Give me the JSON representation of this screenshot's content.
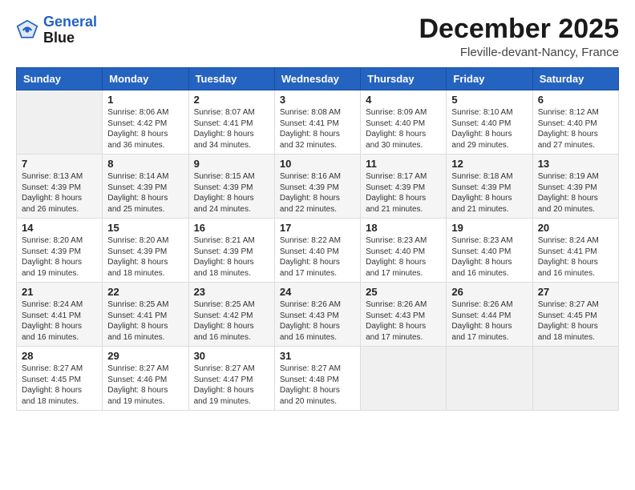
{
  "header": {
    "logo_line1": "General",
    "logo_line2": "Blue",
    "month": "December 2025",
    "location": "Fleville-devant-Nancy, France"
  },
  "days_of_week": [
    "Sunday",
    "Monday",
    "Tuesday",
    "Wednesday",
    "Thursday",
    "Friday",
    "Saturday"
  ],
  "weeks": [
    [
      {
        "day": "",
        "info": ""
      },
      {
        "day": "1",
        "info": "Sunrise: 8:06 AM\nSunset: 4:42 PM\nDaylight: 8 hours\nand 36 minutes."
      },
      {
        "day": "2",
        "info": "Sunrise: 8:07 AM\nSunset: 4:41 PM\nDaylight: 8 hours\nand 34 minutes."
      },
      {
        "day": "3",
        "info": "Sunrise: 8:08 AM\nSunset: 4:41 PM\nDaylight: 8 hours\nand 32 minutes."
      },
      {
        "day": "4",
        "info": "Sunrise: 8:09 AM\nSunset: 4:40 PM\nDaylight: 8 hours\nand 30 minutes."
      },
      {
        "day": "5",
        "info": "Sunrise: 8:10 AM\nSunset: 4:40 PM\nDaylight: 8 hours\nand 29 minutes."
      },
      {
        "day": "6",
        "info": "Sunrise: 8:12 AM\nSunset: 4:40 PM\nDaylight: 8 hours\nand 27 minutes."
      }
    ],
    [
      {
        "day": "7",
        "info": "Sunrise: 8:13 AM\nSunset: 4:39 PM\nDaylight: 8 hours\nand 26 minutes."
      },
      {
        "day": "8",
        "info": "Sunrise: 8:14 AM\nSunset: 4:39 PM\nDaylight: 8 hours\nand 25 minutes."
      },
      {
        "day": "9",
        "info": "Sunrise: 8:15 AM\nSunset: 4:39 PM\nDaylight: 8 hours\nand 24 minutes."
      },
      {
        "day": "10",
        "info": "Sunrise: 8:16 AM\nSunset: 4:39 PM\nDaylight: 8 hours\nand 22 minutes."
      },
      {
        "day": "11",
        "info": "Sunrise: 8:17 AM\nSunset: 4:39 PM\nDaylight: 8 hours\nand 21 minutes."
      },
      {
        "day": "12",
        "info": "Sunrise: 8:18 AM\nSunset: 4:39 PM\nDaylight: 8 hours\nand 21 minutes."
      },
      {
        "day": "13",
        "info": "Sunrise: 8:19 AM\nSunset: 4:39 PM\nDaylight: 8 hours\nand 20 minutes."
      }
    ],
    [
      {
        "day": "14",
        "info": "Sunrise: 8:20 AM\nSunset: 4:39 PM\nDaylight: 8 hours\nand 19 minutes."
      },
      {
        "day": "15",
        "info": "Sunrise: 8:20 AM\nSunset: 4:39 PM\nDaylight: 8 hours\nand 18 minutes."
      },
      {
        "day": "16",
        "info": "Sunrise: 8:21 AM\nSunset: 4:39 PM\nDaylight: 8 hours\nand 18 minutes."
      },
      {
        "day": "17",
        "info": "Sunrise: 8:22 AM\nSunset: 4:40 PM\nDaylight: 8 hours\nand 17 minutes."
      },
      {
        "day": "18",
        "info": "Sunrise: 8:23 AM\nSunset: 4:40 PM\nDaylight: 8 hours\nand 17 minutes."
      },
      {
        "day": "19",
        "info": "Sunrise: 8:23 AM\nSunset: 4:40 PM\nDaylight: 8 hours\nand 16 minutes."
      },
      {
        "day": "20",
        "info": "Sunrise: 8:24 AM\nSunset: 4:41 PM\nDaylight: 8 hours\nand 16 minutes."
      }
    ],
    [
      {
        "day": "21",
        "info": "Sunrise: 8:24 AM\nSunset: 4:41 PM\nDaylight: 8 hours\nand 16 minutes."
      },
      {
        "day": "22",
        "info": "Sunrise: 8:25 AM\nSunset: 4:41 PM\nDaylight: 8 hours\nand 16 minutes."
      },
      {
        "day": "23",
        "info": "Sunrise: 8:25 AM\nSunset: 4:42 PM\nDaylight: 8 hours\nand 16 minutes."
      },
      {
        "day": "24",
        "info": "Sunrise: 8:26 AM\nSunset: 4:43 PM\nDaylight: 8 hours\nand 16 minutes."
      },
      {
        "day": "25",
        "info": "Sunrise: 8:26 AM\nSunset: 4:43 PM\nDaylight: 8 hours\nand 17 minutes."
      },
      {
        "day": "26",
        "info": "Sunrise: 8:26 AM\nSunset: 4:44 PM\nDaylight: 8 hours\nand 17 minutes."
      },
      {
        "day": "27",
        "info": "Sunrise: 8:27 AM\nSunset: 4:45 PM\nDaylight: 8 hours\nand 18 minutes."
      }
    ],
    [
      {
        "day": "28",
        "info": "Sunrise: 8:27 AM\nSunset: 4:45 PM\nDaylight: 8 hours\nand 18 minutes."
      },
      {
        "day": "29",
        "info": "Sunrise: 8:27 AM\nSunset: 4:46 PM\nDaylight: 8 hours\nand 19 minutes."
      },
      {
        "day": "30",
        "info": "Sunrise: 8:27 AM\nSunset: 4:47 PM\nDaylight: 8 hours\nand 19 minutes."
      },
      {
        "day": "31",
        "info": "Sunrise: 8:27 AM\nSunset: 4:48 PM\nDaylight: 8 hours\nand 20 minutes."
      },
      {
        "day": "",
        "info": ""
      },
      {
        "day": "",
        "info": ""
      },
      {
        "day": "",
        "info": ""
      }
    ]
  ]
}
